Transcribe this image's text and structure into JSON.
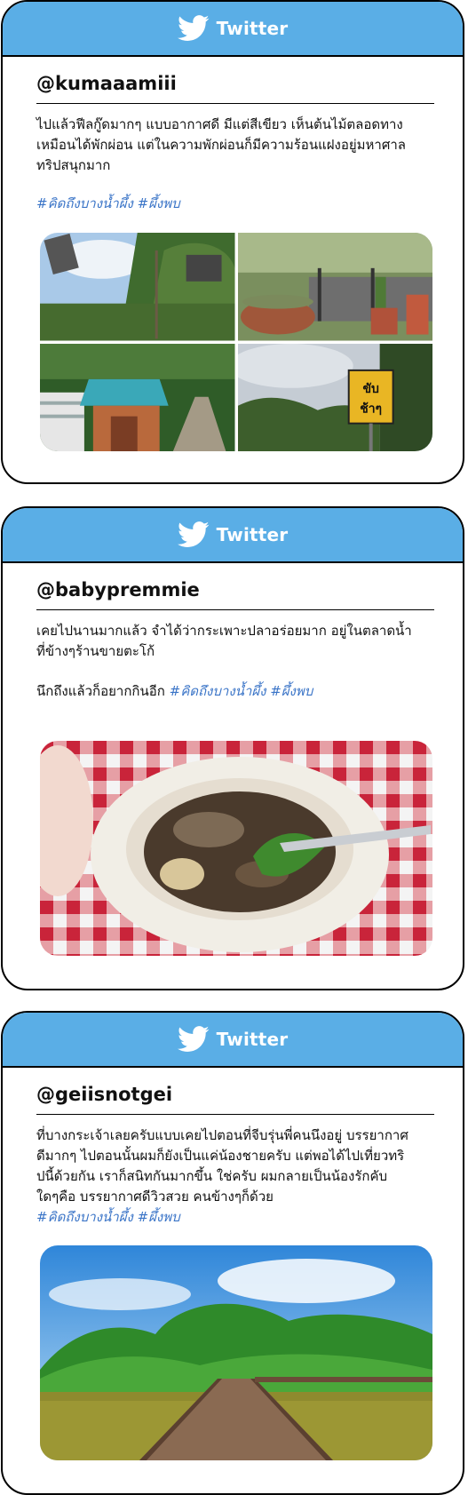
{
  "brand": "Twitter",
  "colors": {
    "header": "#5aaee6",
    "hashtag": "#3a74c7",
    "border": "#000000"
  },
  "cards": [
    {
      "handle": "@kumaaamiii",
      "text_lines": [
        "ไปแล้วฟีลกู๊ดมากๆ แบบอากาศดี มีแต่สีเขียว เห็นต้นไม้ตลอดทาง",
        "เหมือนได้พักผ่อน แต่ในความพักผ่อนก็มีความร้อนแฝงอยู่มหาศาล",
        "ทริปสนุกมาก"
      ],
      "hashtags": "#คิดถึงบางน้ำผึ้ง #ผึ้งพบ",
      "images": [
        "tree-sky-photo",
        "cactus-pots-photo",
        "shop-kiosk-photo",
        "yellow-sign-photo"
      ]
    },
    {
      "handle": "@babypremmie",
      "text_lines": [
        "เคยไปนานมากแล้ว จำได้ว่ากระเพาะปลาอร่อยมาก อยู่ในตลาดน้ำ",
        "ที่ข้างๆร้านขายตะโก้"
      ],
      "text2": "นึกถึงแล้วก็อยากกินอีก",
      "hashtags": "#คิดถึงบางน้ำผึ้ง #ผึ้งพบ",
      "images": [
        "fish-maw-soup-photo"
      ]
    },
    {
      "handle": "@geiisnotgei",
      "text_lines": [
        "ที่บางกระเจ้าเลยครับแบบเคยไปตอนที่จีบรุ่นพี่คนนึงอยู่ บรรยากาศ",
        "ดีมากๆ ไปตอนนั้นผมก็ยังเป็นแค่น้องชายครับ แต่พอได้ไปเที่ยวทริ",
        "ปนี้ด้วยกัน เราก็สนิทกันมากขึ้น ใช่ครับ ผมกลายเป็นน้องรักคับ",
        "ใดๆคือ บรรยากาศดีวิวสวย คนข้างๆก็ด้วย"
      ],
      "hashtags": "#คิดถึงบางน้ำผึ้ง #ผึ้งพบ",
      "images": [
        "wooden-bridge-lake-photo"
      ]
    }
  ]
}
